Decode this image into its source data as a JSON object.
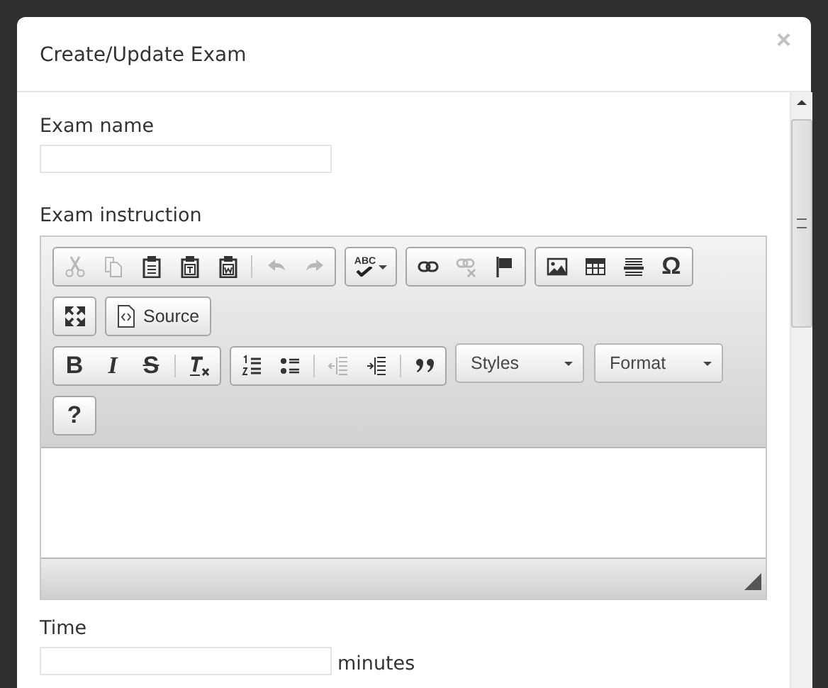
{
  "dialog": {
    "title": "Create/Update Exam",
    "close": "×"
  },
  "fields": [
    {
      "kind": "text",
      "label": "Exam name"
    },
    {
      "kind": "editor",
      "label": "Exam instruction"
    },
    {
      "kind": "number",
      "label": "Time",
      "suffix": "minutes"
    }
  ],
  "toolbar_rows": [
    [
      {
        "buttons": [
          {
            "kind": "icon",
            "disabled": true
          },
          {
            "kind": "icon",
            "disabled": true
          },
          {
            "kind": "icon",
            "disabled": false
          },
          {
            "kind": "icon",
            "disabled": false
          },
          {
            "kind": "icon",
            "disabled": false
          },
          {
            "kind": "separator"
          },
          {
            "kind": "icon",
            "disabled": true
          },
          {
            "kind": "icon",
            "disabled": true
          }
        ]
      },
      {
        "buttons": [
          {
            "kind": "spell",
            "label": "ABC",
            "disabled": false
          }
        ]
      },
      {
        "buttons": [
          {
            "kind": "icon",
            "disabled": false
          },
          {
            "kind": "icon",
            "disabled": true
          },
          {
            "kind": "icon",
            "disabled": false
          }
        ]
      },
      {
        "buttons": [
          {
            "kind": "icon",
            "disabled": false
          },
          {
            "kind": "icon",
            "disabled": false
          },
          {
            "kind": "icon",
            "disabled": false
          },
          {
            "kind": "glyph",
            "label": "Ω",
            "disabled": false
          }
        ]
      }
    ],
    [
      {
        "buttons": [
          {
            "kind": "icon",
            "disabled": false
          }
        ]
      },
      {
        "buttons": [
          {
            "kind": "text",
            "label": "Source",
            "disabled": false
          }
        ]
      }
    ],
    [
      {
        "buttons": [
          {
            "kind": "glyph",
            "label": "B",
            "disabled": false
          },
          {
            "kind": "glyph",
            "label": "I",
            "disabled": false
          },
          {
            "kind": "glyph",
            "label": "S",
            "disabled": false
          },
          {
            "kind": "separator"
          },
          {
            "kind": "icon",
            "disabled": false
          }
        ]
      },
      {
        "buttons": [
          {
            "kind": "icon",
            "disabled": false
          },
          {
            "kind": "icon",
            "disabled": false
          },
          {
            "kind": "separator"
          },
          {
            "kind": "icon",
            "disabled": true
          },
          {
            "kind": "icon",
            "disabled": false
          },
          {
            "kind": "separator"
          },
          {
            "kind": "icon",
            "disabled": false
          }
        ]
      },
      {
        "buttons": [
          {
            "kind": "combo",
            "label": "Styles"
          }
        ]
      },
      {
        "buttons": [
          {
            "kind": "combo",
            "label": "Format"
          }
        ]
      }
    ],
    [
      {
        "buttons": [
          {
            "kind": "glyph",
            "label": "?",
            "disabled": false
          }
        ]
      }
    ]
  ]
}
